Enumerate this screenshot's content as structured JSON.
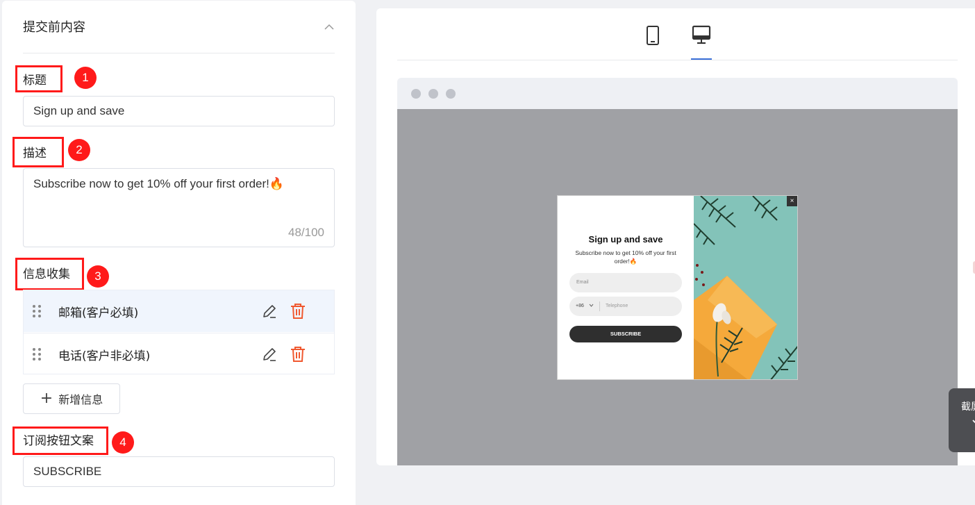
{
  "left_panel": {
    "section_title": "提交前内容",
    "fields": {
      "title_label": "标题",
      "title_value": "Sign up and save",
      "description_label": "描述",
      "description_value": "Subscribe now to get 10% off your first order!🔥",
      "description_counter": "48/100",
      "info_label": "信息收集",
      "info_items": [
        {
          "label": "邮箱(客户必填)"
        },
        {
          "label": "电话(客户非必填)"
        }
      ],
      "add_info_label": "新增信息",
      "button_text_label": "订阅按钮文案",
      "button_text_value": "SUBSCRIBE"
    },
    "annotations": [
      "1",
      "2",
      "3",
      "4"
    ]
  },
  "preview": {
    "devices": [
      "mobile-icon",
      "desktop-icon"
    ],
    "selected_device": "desktop",
    "popup": {
      "title": "Sign up and save",
      "description": "Subscribe now to get 10% off your first order!🔥",
      "email_placeholder": "Email",
      "country_code": "+86",
      "telephone_placeholder": "Telephone",
      "button": "SUBSCRIBE",
      "close": "×"
    }
  },
  "floating_widget": {
    "text": "截屏"
  },
  "colors": {
    "annotation_red": "#ff1a1a",
    "accent_blue": "#3a6fd8",
    "delete_orange": "#f0582f",
    "overlay_gray": "#a0a1a5"
  }
}
